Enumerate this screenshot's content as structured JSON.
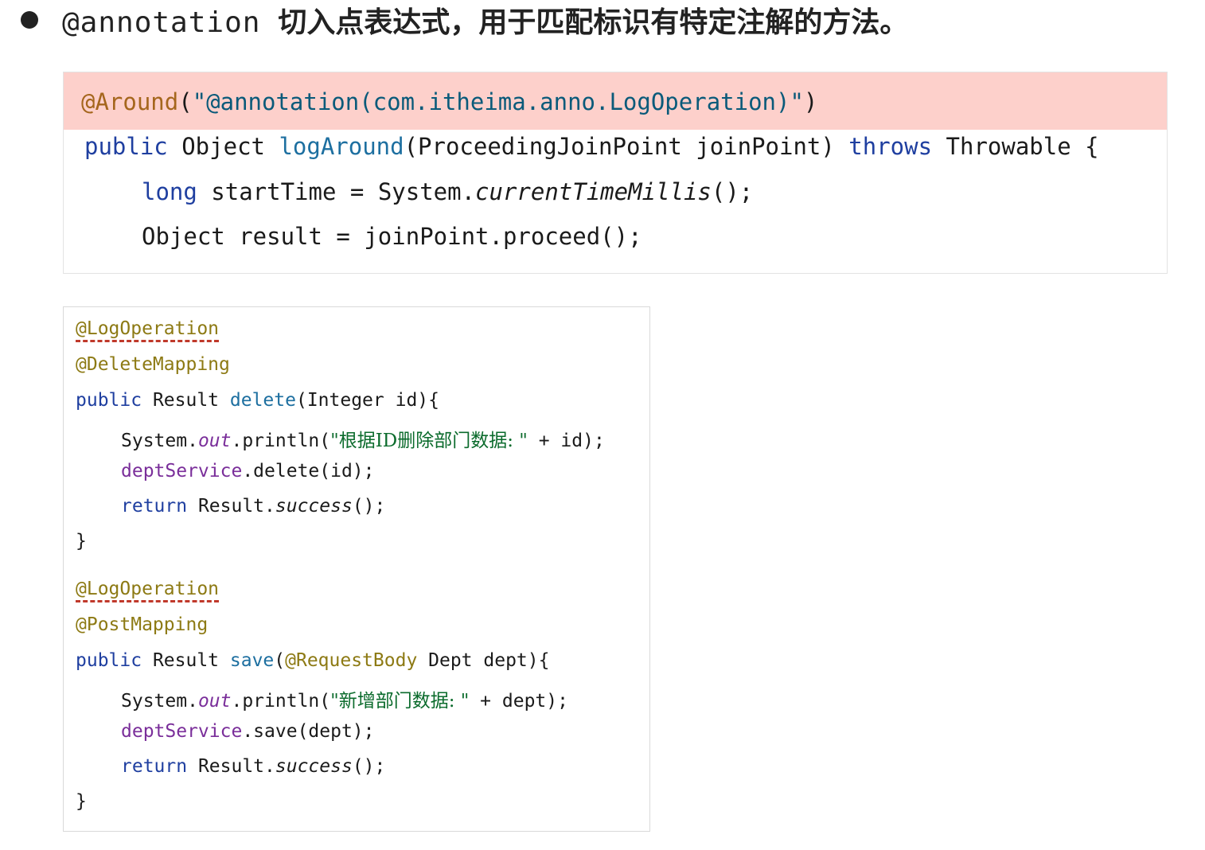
{
  "heading": {
    "mono": "@annotation",
    "cn": "切入点表达式，用于匹配标识有特定注解的方法。"
  },
  "top_code": {
    "l1_ann": "@Around",
    "l1_open": "(",
    "l1_str": "\"@annotation(com.itheima.anno.LogOperation)\"",
    "l1_close": ")",
    "l2_public": "public",
    "l2_obj": " Object ",
    "l2_fn": "logAround",
    "l2_params": "(ProceedingJoinPoint joinPoint) ",
    "l2_throws": "throws",
    "l2_rest": " Throwable {",
    "l3_long": "long",
    "l3_mid": " startTime = System.",
    "l3_it": "currentTimeMillis",
    "l3_end": "();",
    "l4": "Object result = joinPoint.proceed();"
  },
  "bottom_code": {
    "ann_log": "@LogOperation",
    "ann_delete": "@DeleteMapping",
    "d_public": "public",
    "d_result": " Result ",
    "d_fn": "delete",
    "d_params": "(Integer id){",
    "d_sys": "System.",
    "d_out": "out",
    "d_println": ".println(",
    "d_str": "\"根据ID删除部门数据: \"",
    "d_plus": " + id);",
    "d_svc": "deptService",
    "d_svc_call": ".delete(id);",
    "d_return": "return",
    "d_res": " Result.",
    "d_success": "success",
    "d_end": "();",
    "brace": "}",
    "ann_log2": "@LogOperation",
    "ann_post": "@PostMapping",
    "s_public": "public",
    "s_result": " Result ",
    "s_fn": "save",
    "s_open": "(",
    "s_rb": "@RequestBody",
    "s_params": " Dept dept){",
    "s_sys": "System.",
    "s_out": "out",
    "s_println": ".println(",
    "s_str": "\"新增部门数据: \"",
    "s_plus": " + dept);",
    "s_svc": "deptService",
    "s_svc_call": ".save(dept);",
    "s_return": "return",
    "s_res": " Result.",
    "s_success": "success",
    "s_end": "();",
    "brace2": "}"
  }
}
